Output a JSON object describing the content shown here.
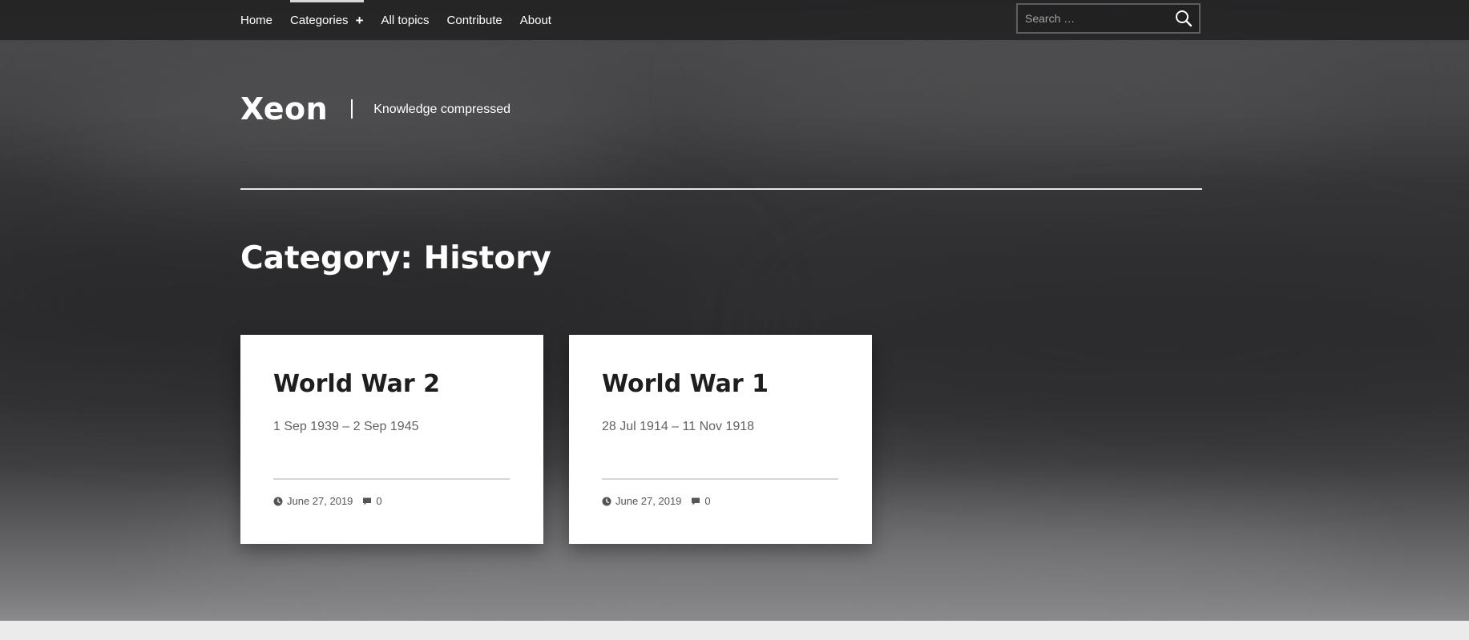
{
  "nav": {
    "items": [
      {
        "label": "Home"
      },
      {
        "label": "Categories"
      },
      {
        "label": "All topics"
      },
      {
        "label": "Contribute"
      },
      {
        "label": "About"
      }
    ],
    "active_item": "Categories",
    "search_placeholder": "Search …"
  },
  "header": {
    "site_title": "Xeon",
    "tagline": "Knowledge compressed"
  },
  "page": {
    "title": "Category: History"
  },
  "posts": [
    {
      "title": "World War 2",
      "excerpt": "1 Sep 1939 – 2 Sep 1945",
      "date": "June 27, 2019",
      "comments": "0"
    },
    {
      "title": "World War 1",
      "excerpt": "28 Jul 1914 – 11 Nov 1918",
      "date": "June 27, 2019",
      "comments": "0"
    }
  ],
  "icons": {
    "category_toggle": "plus-icon",
    "search": "search-icon",
    "date": "clock-icon",
    "comments": "comment-icon"
  },
  "colors": {
    "nav_background": "#222223",
    "card_background": "#ffffff",
    "card_title": "#1e1e20",
    "meta_text": "#555555",
    "page_text": "#ffffff"
  }
}
